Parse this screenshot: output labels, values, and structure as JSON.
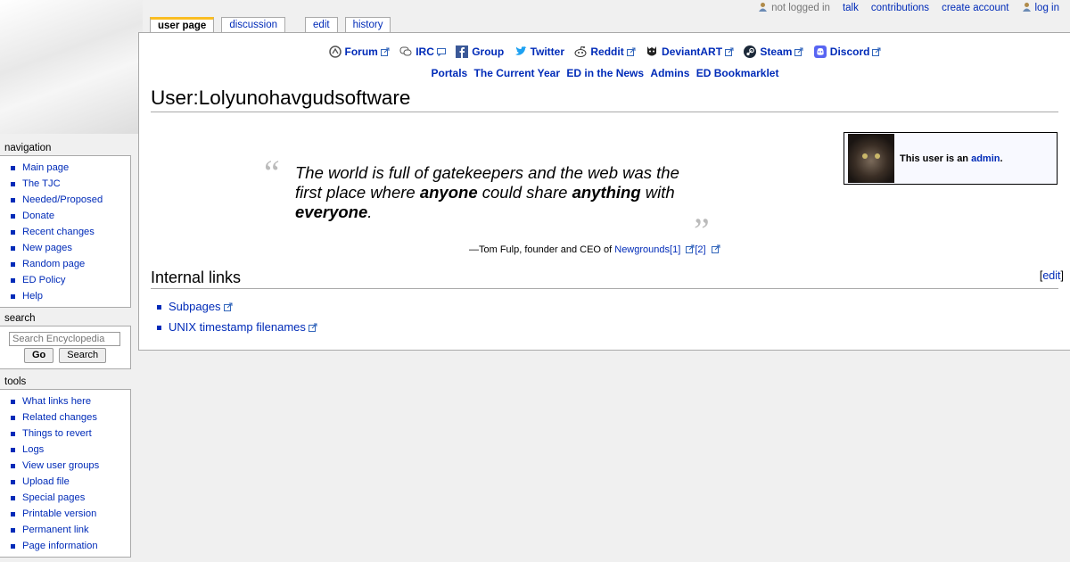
{
  "personal": {
    "not_logged_in": "not logged in",
    "talk": "talk",
    "contributions": "contributions",
    "create_account": "create account",
    "log_in": "log in"
  },
  "tabs": {
    "user_page": "user page",
    "discussion": "discussion",
    "edit": "edit",
    "history": "history"
  },
  "social": [
    {
      "label": "Forum",
      "icon": "forum-icon"
    },
    {
      "label": "IRC",
      "icon": "irc-icon"
    },
    {
      "label": "Group",
      "icon": "facebook-icon"
    },
    {
      "label": "Twitter",
      "icon": "twitter-icon"
    },
    {
      "label": "Reddit",
      "icon": "reddit-icon"
    },
    {
      "label": "DeviantART",
      "icon": "deviantart-icon"
    },
    {
      "label": "Steam",
      "icon": "steam-icon"
    },
    {
      "label": "Discord",
      "icon": "discord-icon"
    }
  ],
  "portals": [
    "Portals",
    "The Current Year",
    "ED in the News",
    "Admins",
    "ED Bookmarklet"
  ],
  "title": "User:Lolyunohavgudsoftware",
  "userbox": {
    "text_prefix": "This user is an ",
    "link": "admin",
    "suffix": "."
  },
  "quote": {
    "part1": "The world is full of gatekeepers and the web was the first place where ",
    "bold1": "anyone",
    "part2": " could share ",
    "bold2": "anything",
    "part3": " with ",
    "bold3": "everyone",
    "part4": ".",
    "attribution": "—Tom Fulp, founder and CEO of ",
    "attribution_link": "Newgrounds",
    "ref1": "[1]",
    "ref2": "[2]"
  },
  "internal": {
    "heading": "Internal links",
    "edit_open": "[",
    "edit": "edit",
    "edit_close": "]",
    "items": [
      "Subpages",
      "UNIX timestamp filenames"
    ]
  },
  "sidebar": {
    "navigation": {
      "heading": "navigation",
      "items": [
        "Main page",
        "The TJC",
        "Needed/Proposed",
        "Donate",
        "Recent changes",
        "New pages",
        "Random page",
        "ED Policy",
        "Help"
      ]
    },
    "search": {
      "heading": "search",
      "placeholder": "Search Encyclopedia",
      "go": "Go",
      "search": "Search"
    },
    "tools": {
      "heading": "tools",
      "items": [
        "What links here",
        "Related changes",
        "Things to revert",
        "Logs",
        "View user groups",
        "Upload file",
        "Special pages",
        "Printable version",
        "Permanent link",
        "Page information"
      ]
    }
  }
}
